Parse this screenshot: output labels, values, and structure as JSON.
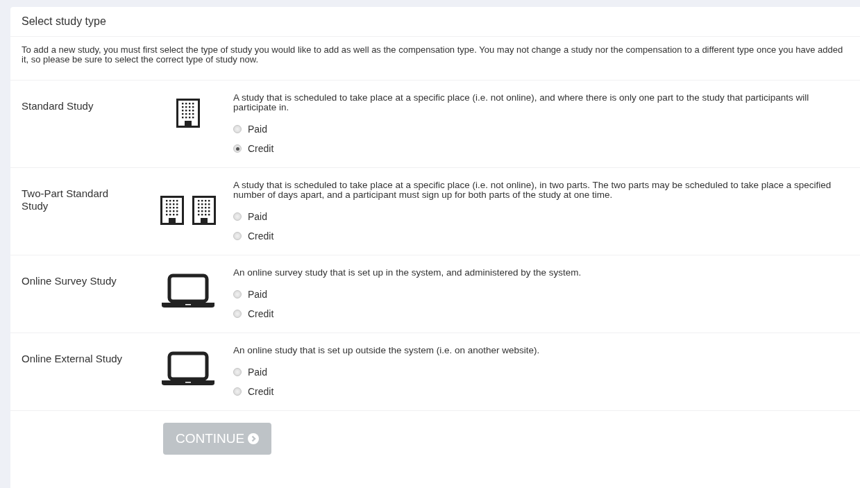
{
  "panel": {
    "title": "Select study type",
    "intro": "To add a new study, you must first select the type of study you would like to add as well as the compensation type. You may not change a study nor the compensation to a different type once you have added it, so please be sure to select the correct type of study now."
  },
  "study_types": [
    {
      "name": "Standard Study",
      "kind": "building",
      "description": "A study that is scheduled to take place at a specific place (i.e. not online), and where there is only one part to the study that participants will participate in.",
      "options": [
        {
          "label": "Paid",
          "selected": false
        },
        {
          "label": "Credit",
          "selected": true
        }
      ]
    },
    {
      "name": "Two-Part Standard Study",
      "kind": "two-buildings",
      "description": "A study that is scheduled to take place at a specific place (i.e. not online), in two parts. The two parts may be scheduled to take place a specified number of days apart, and a participant must sign up for both parts of the study at one time.",
      "options": [
        {
          "label": "Paid",
          "selected": false
        },
        {
          "label": "Credit",
          "selected": false
        }
      ]
    },
    {
      "name": "Online Survey Study",
      "kind": "laptop",
      "description": "An online survey study that is set up in the system, and administered by the system.",
      "options": [
        {
          "label": "Paid",
          "selected": false
        },
        {
          "label": "Credit",
          "selected": false
        }
      ]
    },
    {
      "name": "Online External Study",
      "kind": "laptop",
      "description": "An online study that is set up outside the system (i.e. on another website).",
      "options": [
        {
          "label": "Paid",
          "selected": false
        },
        {
          "label": "Credit",
          "selected": false
        }
      ]
    }
  ],
  "continue_button": {
    "label": "CONTINUE",
    "disabled": true
  }
}
